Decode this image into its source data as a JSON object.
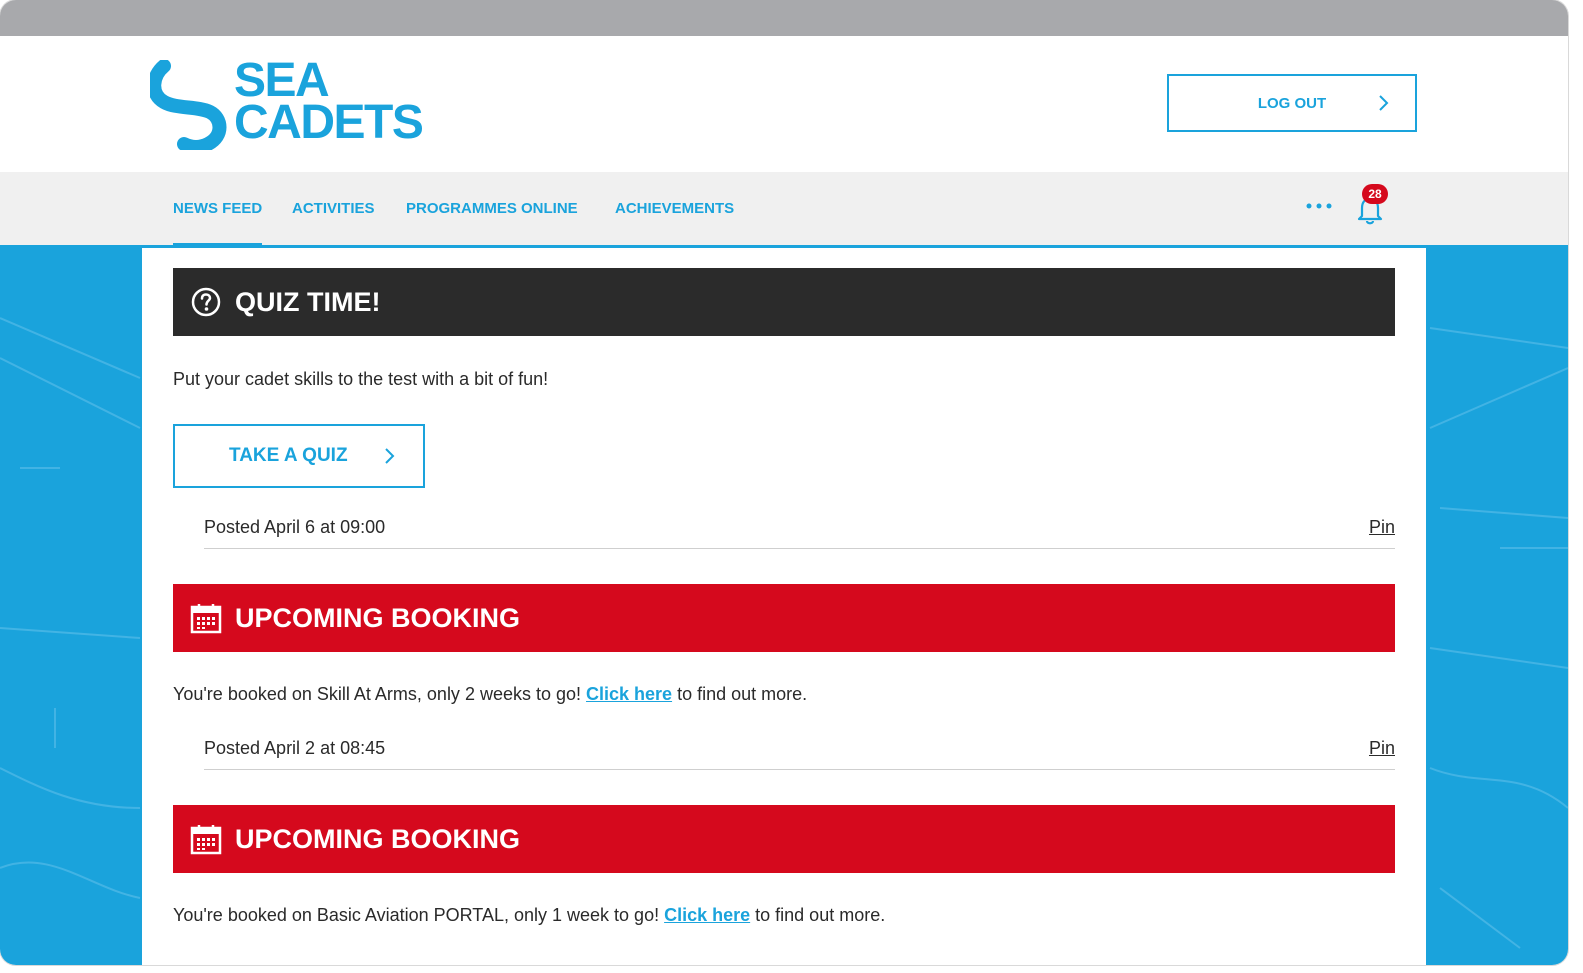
{
  "brand": {
    "line1": "SEA",
    "line2": "CADETS",
    "color": "#1aa3dc"
  },
  "header": {
    "logout_label": "LOG OUT"
  },
  "nav": {
    "items": [
      {
        "label": "NEWS FEED"
      },
      {
        "label": "ACTIVITIES"
      },
      {
        "label": "PROGRAMMES ONLINE"
      },
      {
        "label": "ACHIEVEMENTS"
      }
    ],
    "notification_count": "28"
  },
  "feed": [
    {
      "title": "QUIZ TIME!",
      "icon": "question-circle-icon",
      "text": "Put your cadet skills to the test with a bit of fun!",
      "button": "TAKE A QUIZ",
      "posted": "Posted April 6 at 09:00",
      "pin": "Pin"
    },
    {
      "title": "UPCOMING BOOKING",
      "icon": "calendar-icon",
      "text_before": "You're booked on Skill At Arms, only 2 weeks to go! ",
      "link": "Click here",
      "text_after": " to find out more.",
      "posted": "Posted April 2 at 08:45",
      "pin": "Pin"
    },
    {
      "title": "UPCOMING BOOKING",
      "icon": "calendar-icon",
      "text_before": "You're booked on Basic Aviation PORTAL, only 1 week to go! ",
      "link": "Click here",
      "text_after": " to find out more."
    }
  ],
  "colors": {
    "accent": "#1aa3dc",
    "dark_header": "#2b2b2b",
    "alert_red": "#d5091d"
  }
}
